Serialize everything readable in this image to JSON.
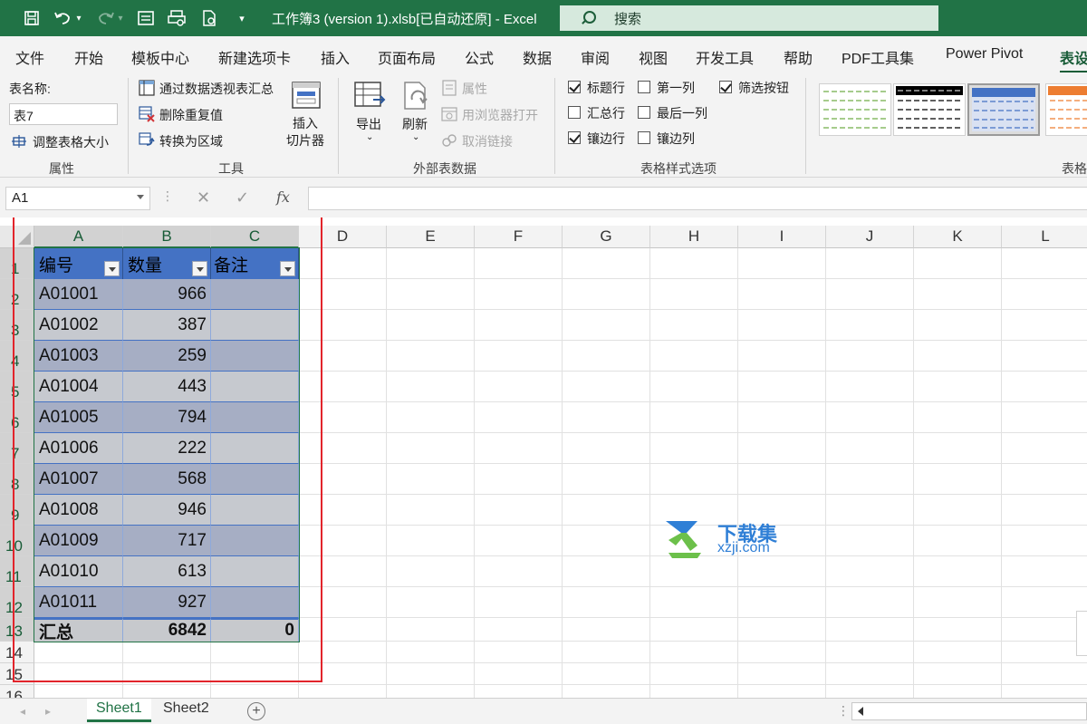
{
  "titlebar": {
    "title": "工作簿3 (version 1).xlsb[已自动还原]  -  Excel",
    "search_placeholder": "搜索"
  },
  "menu": {
    "tabs": [
      "文件",
      "开始",
      "模板中心",
      "新建选项卡",
      "插入",
      "页面布局",
      "公式",
      "数据",
      "审阅",
      "视图",
      "开发工具",
      "帮助",
      "PDF工具集",
      "Power Pivot",
      "表设"
    ],
    "active_index": 14
  },
  "ribbon": {
    "properties": {
      "table_name_label": "表名称:",
      "table_name_value": "表7",
      "resize_label": "调整表格大小",
      "group_label": "属性"
    },
    "tools": {
      "pivot_label": "通过数据透视表汇总",
      "remove_dup_label": "删除重复值",
      "convert_label": "转换为区域",
      "slicer_label_1": "插入",
      "slicer_label_2": "切片器",
      "group_label": "工具"
    },
    "external": {
      "export_label": "导出",
      "refresh_label": "刷新",
      "properties_label": "属性",
      "browser_label": "用浏览器打开",
      "unlink_label": "取消链接",
      "group_label": "外部表数据"
    },
    "style_options": {
      "header_row": "标题行",
      "first_column": "第一列",
      "filter_button": "筛选按钮",
      "total_row": "汇总行",
      "last_column": "最后一列",
      "banded_rows": "镶边行",
      "banded_columns": "镶边列",
      "header_row_checked": true,
      "first_column_checked": false,
      "filter_button_checked": true,
      "total_row_checked": false,
      "last_column_checked": false,
      "banded_rows_checked": true,
      "banded_columns_checked": false,
      "group_label": "表格样式选项"
    },
    "styles": {
      "group_label": "表格"
    }
  },
  "formula_bar": {
    "name_box": "A1",
    "cancel_glyph": "✕",
    "enter_glyph": "✓",
    "fx_glyph": "fx",
    "formula": ""
  },
  "grid": {
    "columns": [
      "A",
      "B",
      "C",
      "D",
      "E",
      "F",
      "G",
      "H",
      "I",
      "J",
      "K",
      "L"
    ],
    "rows": [
      "1",
      "2",
      "3",
      "4",
      "5",
      "6",
      "7",
      "8",
      "9",
      "10",
      "11",
      "12",
      "13",
      "14",
      "15",
      "16"
    ],
    "table_headers": [
      "编号",
      "数量",
      "备注"
    ],
    "table_rows": [
      [
        "A01001",
        "966",
        ""
      ],
      [
        "A01002",
        "387",
        ""
      ],
      [
        "A01003",
        "259",
        ""
      ],
      [
        "A01004",
        "443",
        ""
      ],
      [
        "A01005",
        "794",
        ""
      ],
      [
        "A01006",
        "222",
        ""
      ],
      [
        "A01007",
        "568",
        ""
      ],
      [
        "A01008",
        "946",
        ""
      ],
      [
        "A01009",
        "717",
        ""
      ],
      [
        "A01010",
        "613",
        ""
      ],
      [
        "A01011",
        "927",
        ""
      ]
    ],
    "total_row": [
      "汇总",
      "6842",
      "0"
    ]
  },
  "watermark": {
    "name": "下载集",
    "url": "xzji.com"
  },
  "sheets": {
    "tabs": [
      "Sheet1",
      "Sheet2"
    ],
    "active_index": 0,
    "add_glyph": "+"
  },
  "colors": {
    "excel_green": "#217346",
    "table_header": "#4472c4",
    "highlight_red": "#e2242b"
  }
}
